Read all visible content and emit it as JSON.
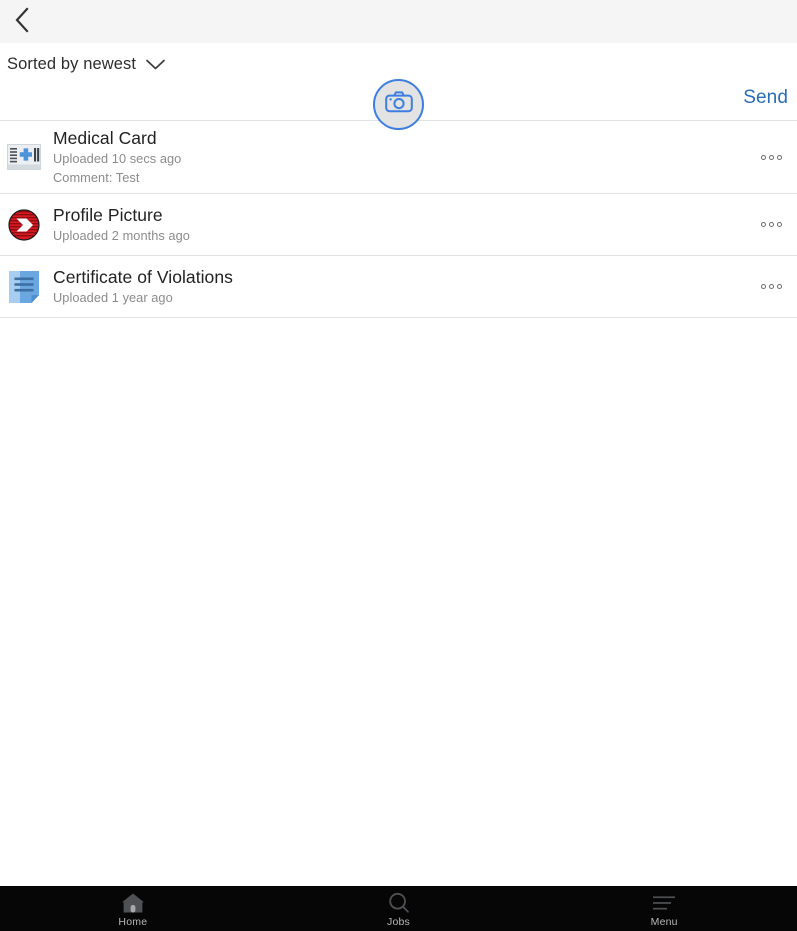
{
  "topbar": {
    "back_icon": "chevron-left-icon"
  },
  "sort": {
    "label": "Sorted by newest",
    "chevron_icon": "chevron-down-icon"
  },
  "actions": {
    "camera_icon": "camera-icon",
    "send_label": "Send"
  },
  "documents": [
    {
      "icon": "medical-card-icon",
      "title": "Medical Card",
      "uploaded": "Uploaded 10 secs ago",
      "comment": "Comment: Test",
      "more_icon": "more-horizontal-icon"
    },
    {
      "icon": "profile-picture-icon",
      "title": "Profile Picture",
      "uploaded": "Uploaded 2 months ago",
      "comment": null,
      "more_icon": "more-horizontal-icon"
    },
    {
      "icon": "certificate-document-icon",
      "title": "Certificate of Violations",
      "uploaded": "Uploaded 1 year ago",
      "comment": null,
      "more_icon": "more-horizontal-icon"
    }
  ],
  "bottom_nav": [
    {
      "icon": "home-icon",
      "label": "Home"
    },
    {
      "icon": "search-icon",
      "label": "Jobs"
    },
    {
      "icon": "hamburger-menu-icon",
      "label": "Menu"
    }
  ],
  "colors": {
    "accent_blue": "#2b6cb8",
    "camera_border_blue": "#3d7ee0",
    "topbar_bg": "#f5f5f5",
    "divider": "#dfe3e8",
    "nav_bg": "#060606",
    "nav_label": "#b8b8b8",
    "title_text": "#222222",
    "sub_text": "#8b8b8b"
  }
}
